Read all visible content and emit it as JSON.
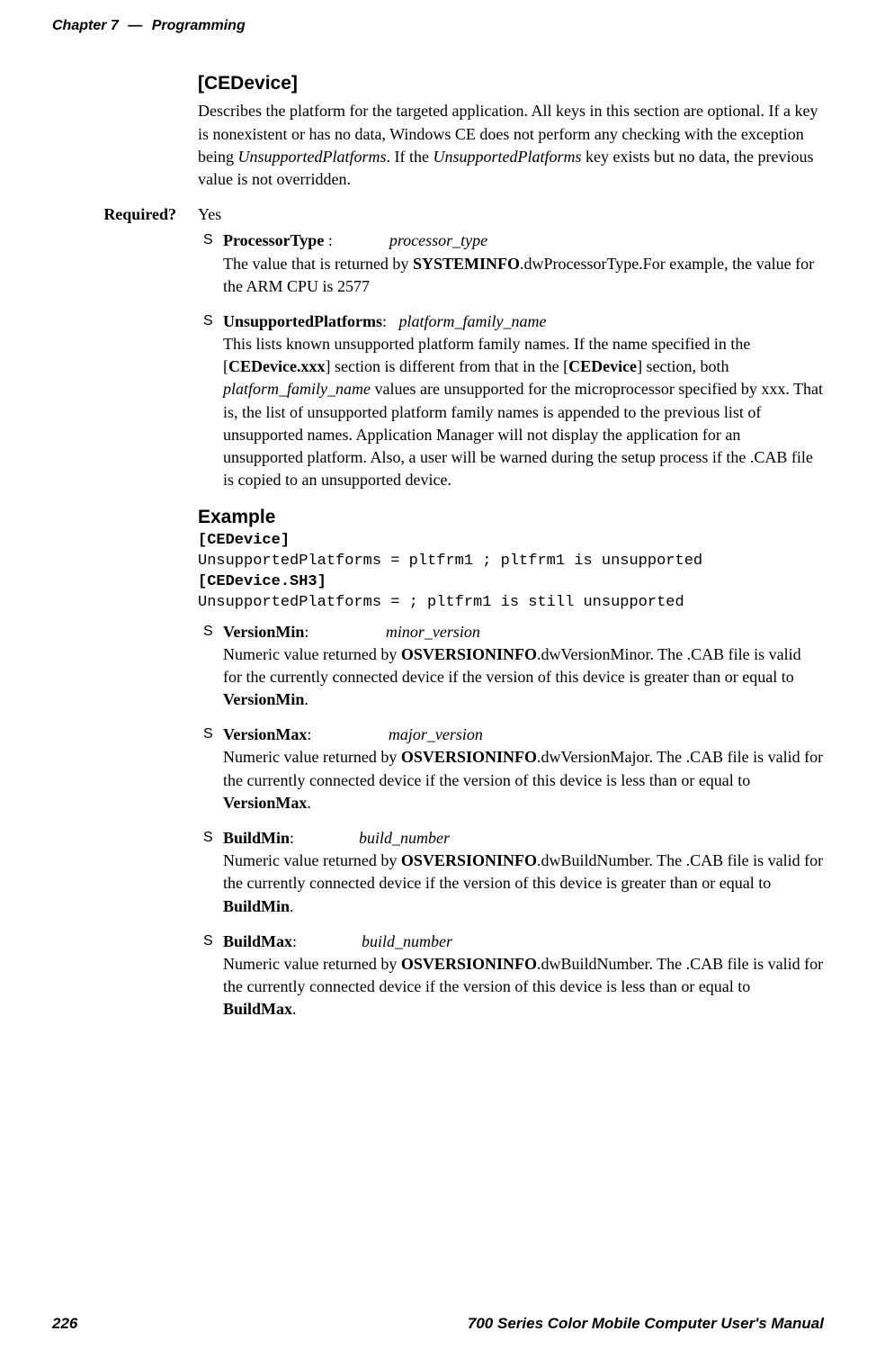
{
  "header": {
    "chapter": "Chapter 7",
    "sep": "—",
    "title": "Programming"
  },
  "section": {
    "title": "[CEDevice]",
    "body": "Describes the platform for the targeted application. All keys in this section are optional. If a key is nonexistent or has no data, Windows CE does not perform any checking with the exception being UnsupportedPlatforms. If the UnsupportedPlatforms key exists but no data, the previous value is not overridden."
  },
  "required": {
    "label": "Required?",
    "value": "Yes"
  },
  "bullets1": [
    {
      "key": "ProcessorType",
      "colon": " :",
      "val": "processor_type",
      "desc": "The value that is returned by SYSTEMINFO.dwProcessorType.For example, the value for the ARM CPU is 2577"
    },
    {
      "key": "UnsupportedPlatforms",
      "colon": ":",
      "val": "platform_family_name",
      "desc": "This lists known unsupported platform family names. If the name specified in the [CEDevice.xxx] section is different from that in the [CEDevice] section, both platform_family_name values are unsupported for the microprocessor specified by xxx. That is, the list of unsupported platform family names is appended to the previous list of unsupported names. Application Manager will not display the application for an unsupported platform. Also, a user will be warned during the setup process if the .CAB file is copied to an unsupported device."
    }
  ],
  "example": {
    "title": "Example",
    "line1b": "[CEDevice]",
    "line2": "UnsupportedPlatforms = pltfrm1 ; pltfrm1 is unsupported",
    "line3b": "[CEDevice.SH3]",
    "line4": "UnsupportedPlatforms = ; pltfrm1 is still unsupported"
  },
  "bullets2": [
    {
      "key": "VersionMin",
      "colon": ":",
      "val": "minor_version",
      "desc": "Numeric value returned by OSVERSIONINFO.dwVersionMinor. The .CAB file is valid for the currently connected device if the version of this device is greater than or equal to VersionMin."
    },
    {
      "key": "VersionMax",
      "colon": ":",
      "val": "major_version",
      "desc": "Numeric value returned by OSVERSIONINFO.dwVersionMajor. The .CAB file is valid for the currently connected device if the version of this device is less than or equal to VersionMax."
    },
    {
      "key": "BuildMin",
      "colon": ":",
      "val": "build_number",
      "desc": "Numeric value returned by OSVERSIONINFO.dwBuildNumber. The .CAB file is valid for the currently connected device if the version of this device is greater than or equal to BuildMin."
    },
    {
      "key": "BuildMax",
      "colon": ":",
      "val": "build_number",
      "desc": "Numeric value returned by OSVERSIONINFO.dwBuildNumber. The .CAB file is valid for the currently connected device if the version of this device is less than or equal to BuildMax."
    }
  ],
  "footer": {
    "page": "226",
    "manual": "700 Series Color Mobile Computer User's Manual"
  }
}
